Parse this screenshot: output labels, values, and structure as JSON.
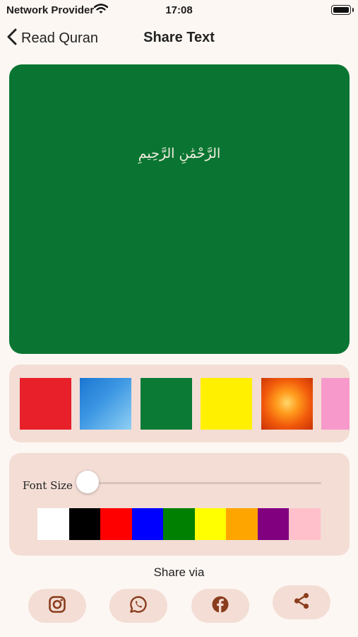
{
  "status": {
    "carrier": "Network Provider",
    "time": "17:08"
  },
  "nav": {
    "back_label": "Read Quran",
    "title": "Share Text"
  },
  "preview": {
    "background_color": "#0a7532",
    "text": "الرَّحْمَٰنِ الرَّحِيمِ",
    "text_color": "#f4efe2"
  },
  "backgrounds": [
    {
      "name": "red",
      "fill": "#e8202a"
    },
    {
      "name": "blue-gradient",
      "fill": "linear-gradient(135deg,#1b76d2 0%,#3d97e3 45%,#8fd0f4 100%)"
    },
    {
      "name": "green",
      "fill": "#0a7a35"
    },
    {
      "name": "yellow",
      "fill": "#fff000"
    },
    {
      "name": "orange-burst",
      "fill": "radial-gradient(circle at 50% 48%, #ffd76a 0%, #ff9a1c 30%, #f15a0b 62%, #c83205 100%)"
    },
    {
      "name": "pink",
      "fill": "#f79acb"
    }
  ],
  "font_settings": {
    "label": "Font Size",
    "size_fraction": 0.02,
    "colors": [
      "#ffffff",
      "#000000",
      "#ff0000",
      "#0000ff",
      "#008000",
      "#ffff00",
      "#ffa500",
      "#800080",
      "#ffc0cb"
    ]
  },
  "share": {
    "label": "Share via",
    "buttons": [
      "instagram",
      "whatsapp",
      "facebook",
      "share"
    ],
    "icon_color": "#8a3d1c"
  }
}
